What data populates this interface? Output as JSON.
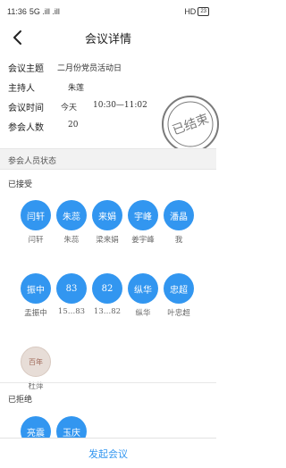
{
  "status_bar": {
    "time": "11:36",
    "signal_text": "5G .ill .ill",
    "hd": "HD",
    "battery": "23"
  },
  "nav": {
    "title": "会议详情"
  },
  "info": {
    "topic_label": "会议主题",
    "topic_value": "二月份党员活动日",
    "host_label": "主持人",
    "host_value": "朱莲",
    "time_label": "会议时间",
    "time_day": "今天",
    "time_range": "10:30—11:02",
    "count_label": "参会人数",
    "count_value": "20"
  },
  "stamp": {
    "text": "已结束",
    "color": "#7a7a7a"
  },
  "band": {
    "label": "参会人员状态"
  },
  "accepted": {
    "label": "已接受",
    "people": [
      {
        "avatar": "闫轩",
        "name": "闫轩"
      },
      {
        "avatar": "朱蕊",
        "name": "朱蕊"
      },
      {
        "avatar": "来娟",
        "name": "梁来娟"
      },
      {
        "avatar": "宇峰",
        "name": "姜宇峰"
      },
      {
        "avatar": "潘晶",
        "name": "我"
      },
      {
        "avatar": "振中",
        "name": "盂振中"
      },
      {
        "avatar": "83",
        "name": "15…83"
      },
      {
        "avatar": "82",
        "name": "13…82"
      },
      {
        "avatar": "纵华",
        "name": "纵华"
      },
      {
        "avatar": "忠超",
        "name": "叶忠超"
      },
      {
        "avatar": "百年",
        "name": "杜萍"
      }
    ]
  },
  "declined": {
    "label": "已拒绝",
    "people": [
      {
        "avatar": "亮震"
      },
      {
        "avatar": "玉庆"
      }
    ]
  },
  "bottom": {
    "label": "发起会议"
  },
  "colors": {
    "accent": "#3296f0"
  }
}
